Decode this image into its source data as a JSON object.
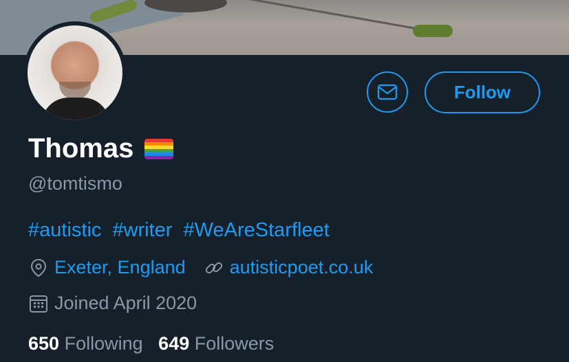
{
  "profile": {
    "name": "Thomas",
    "handle": "@tomtismo",
    "bio_tags": [
      "#autistic",
      "#writer",
      "#WeAreStarfleet"
    ],
    "location": "Exeter, England",
    "website": "autisticpoet.co.uk",
    "joined": "Joined April 2020"
  },
  "actions": {
    "follow_label": "Follow",
    "message_icon": "mail-icon"
  },
  "stats": {
    "following_count": "650",
    "following_label": "Following",
    "followers_count": "649",
    "followers_label": "Followers"
  },
  "colors": {
    "background": "#15202b",
    "accent": "#1d9bf0",
    "secondary_text": "#8899a6"
  }
}
